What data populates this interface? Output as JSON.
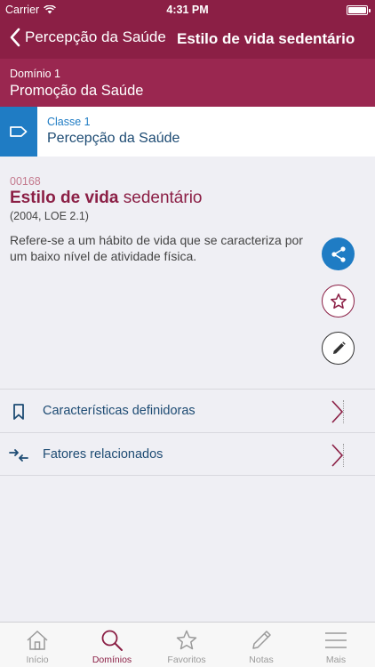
{
  "status_bar": {
    "carrier": "Carrier",
    "time": "4:31 PM"
  },
  "nav": {
    "back_label": "Percepção da Saúde",
    "title": "Estilo de vida sedentário"
  },
  "domain": {
    "label": "Domínio 1",
    "name": "Promoção da Saúde"
  },
  "class": {
    "label": "Classe 1",
    "name": "Percepção da Saúde"
  },
  "diagnosis": {
    "code": "00168",
    "title_main": "Estilo de vida",
    "title_sub": "sedentário",
    "meta": "(2004, LOE 2.1)",
    "definition": "Refere-se a um hábito de vida que se caracteriza por um baixo nível de atividade física."
  },
  "actions": [
    {
      "name": "share",
      "icon": "share-icon"
    },
    {
      "name": "favorite",
      "icon": "star-outline-icon"
    },
    {
      "name": "edit",
      "icon": "pencil-icon"
    }
  ],
  "sections": [
    {
      "label": "Características definidoras",
      "icon": "bookmark-icon"
    },
    {
      "label": "Fatores relacionados",
      "icon": "arrows-in-icon"
    }
  ],
  "tabs": [
    {
      "label": "Início",
      "icon": "home-icon",
      "active": false
    },
    {
      "label": "Domínios",
      "icon": "search-icon",
      "active": true
    },
    {
      "label": "Favoritos",
      "icon": "star-icon",
      "active": false
    },
    {
      "label": "Notas",
      "icon": "pencil-icon",
      "active": false
    },
    {
      "label": "Mais",
      "icon": "menu-icon",
      "active": false
    }
  ],
  "colors": {
    "brand": "#8b1f45",
    "domain_bar": "#9a2750",
    "accent_blue": "#1f7cc4",
    "text_navy": "#1d4b73",
    "background": "#efeff4"
  }
}
